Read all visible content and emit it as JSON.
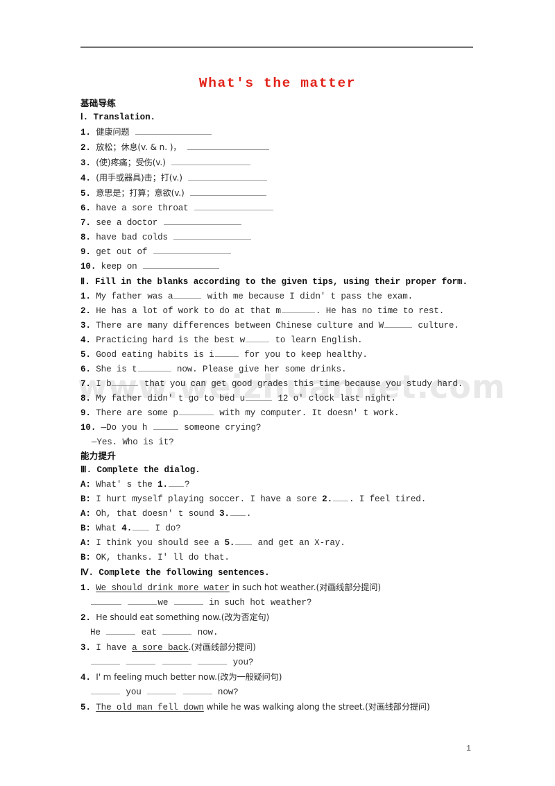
{
  "document": {
    "title": "What's the matter",
    "title_color": "#e2231a",
    "page_number": "1",
    "watermark": "www.weizhuannet.com"
  },
  "section_headings": {
    "basic": "基础导练",
    "ability": "能力提升"
  },
  "part1": {
    "heading": "Ⅰ. Translation.",
    "items": [
      {
        "num": "1.",
        "text": "健康问题",
        "blank": 110
      },
      {
        "num": "2.",
        "text": "放松；休息(v. & n. )，",
        "blank": 118
      },
      {
        "num": "3.",
        "text": "(使)疼痛；受伤(v.)",
        "blank": 114
      },
      {
        "num": "4.",
        "text": "(用手或器具)击；打(v.)",
        "blank": 114
      },
      {
        "num": "5.",
        "text": "意思是；打算；意欲(v.)",
        "blank": 110
      },
      {
        "num": "6.",
        "text": "have a sore throat",
        "blank": 114
      },
      {
        "num": "7.",
        "text": "see a doctor",
        "blank": 112
      },
      {
        "num": "8.",
        "text": "have bad colds",
        "blank": 112
      },
      {
        "num": "9.",
        "text": "get out of",
        "blank": 112
      },
      {
        "num": "10.",
        "text": "keep on",
        "blank": 110
      }
    ]
  },
  "part2": {
    "heading": "Ⅱ. Fill in the blanks according to the given tips, using their proper form.",
    "items": [
      {
        "num": "1.",
        "pre": "My father was a",
        "blank": 40,
        "post": " with me because I didn' t pass the exam."
      },
      {
        "num": "2.",
        "pre": "He has a lot of work to do at that m",
        "blank": 48,
        "post": ". He has no time to rest."
      },
      {
        "num": "3.",
        "pre": "There are many differences between Chinese culture and W",
        "blank": 40,
        "post": " culture."
      },
      {
        "num": "4.",
        "pre": "Practicing hard is the best w",
        "blank": 34,
        "post": " to learn English."
      },
      {
        "num": "5.",
        "pre": "Good eating habits is i",
        "blank": 34,
        "post": " for you to keep healthy."
      },
      {
        "num": "6.",
        "pre": "She is t",
        "blank": 48,
        "post": " now. Please give her some drinks."
      },
      {
        "num": "7.",
        "pre": "I b",
        "blank": 38,
        "post": " that you can get good grades this time because you study hard."
      },
      {
        "num": "8.",
        "pre": "My father didn' t go to bed u",
        "blank": 38,
        "post": " 12 o' clock last night."
      },
      {
        "num": "9.",
        "pre": "There are some p",
        "blank": 50,
        "post": " with my computer. It doesn' t work."
      },
      {
        "num": "10.",
        "pre": "—Do you h ",
        "blank": 36,
        "post": " someone crying?"
      }
    ],
    "item10_reply": "—Yes. Who is it?"
  },
  "part3": {
    "heading": "Ⅲ. Complete the dialog.",
    "lines": [
      {
        "speaker": "A:",
        "pre": " What' s the ",
        "num": "1.",
        "blank": 22,
        "post": "?"
      },
      {
        "speaker": "B:",
        "pre": " I hurt myself playing soccer. I have a sore ",
        "num": "2.",
        "blank": 22,
        "post": ". I feel tired."
      },
      {
        "speaker": "A:",
        "pre": " Oh, that doesn' t sound ",
        "num": "3.",
        "blank": 22,
        "post": "."
      },
      {
        "speaker": "B:",
        "pre": " What ",
        "num": "4.",
        "blank": 24,
        "post": " I do?"
      },
      {
        "speaker": "A:",
        "pre": " I think you should see a ",
        "num": "5.",
        "blank": 24,
        "post": " and get an X-ray."
      },
      {
        "speaker": "B:",
        "pre": " OK, thanks. I' ll do that.",
        "num": "",
        "blank": 0,
        "post": ""
      }
    ]
  },
  "part4": {
    "heading": "Ⅳ. Complete the following sentences.",
    "items": [
      {
        "num": "1.",
        "underlined": "We should drink more water",
        "rest": " in such hot weather.(对画线部分提问)",
        "answer_pre": "",
        "answer_blanks": [
          44,
          42
        ],
        "answer_mid": "we",
        "answer_blank2": 42,
        "answer_post": " in such hot weather?"
      },
      {
        "num": "2.",
        "underlined": "",
        "rest": "He should eat something now.(改为否定句)",
        "answer_pre": "He ",
        "answer_blanks": [
          42
        ],
        "answer_mid": "eat",
        "answer_blank2": 42,
        "answer_post": " now."
      },
      {
        "num": "3.",
        "underlined": "a sore back",
        "pre": "I have ",
        "rest": ".(对画线部分提问)",
        "answer_blanks4": [
          42,
          42,
          42,
          42
        ],
        "answer_post": " you?"
      },
      {
        "num": "4.",
        "underlined": "",
        "rest": "I' m feeling much better now.(改为一般疑问句)",
        "answer_pre": "",
        "answer_blanks": [
          42
        ],
        "answer_mid": "you",
        "answer_blanks_after": [
          42,
          42
        ],
        "answer_post": " now?"
      },
      {
        "num": "5.",
        "underlined": "The old man fell down",
        "rest": " while he was walking along the street.(对画线部分提问)"
      }
    ]
  }
}
